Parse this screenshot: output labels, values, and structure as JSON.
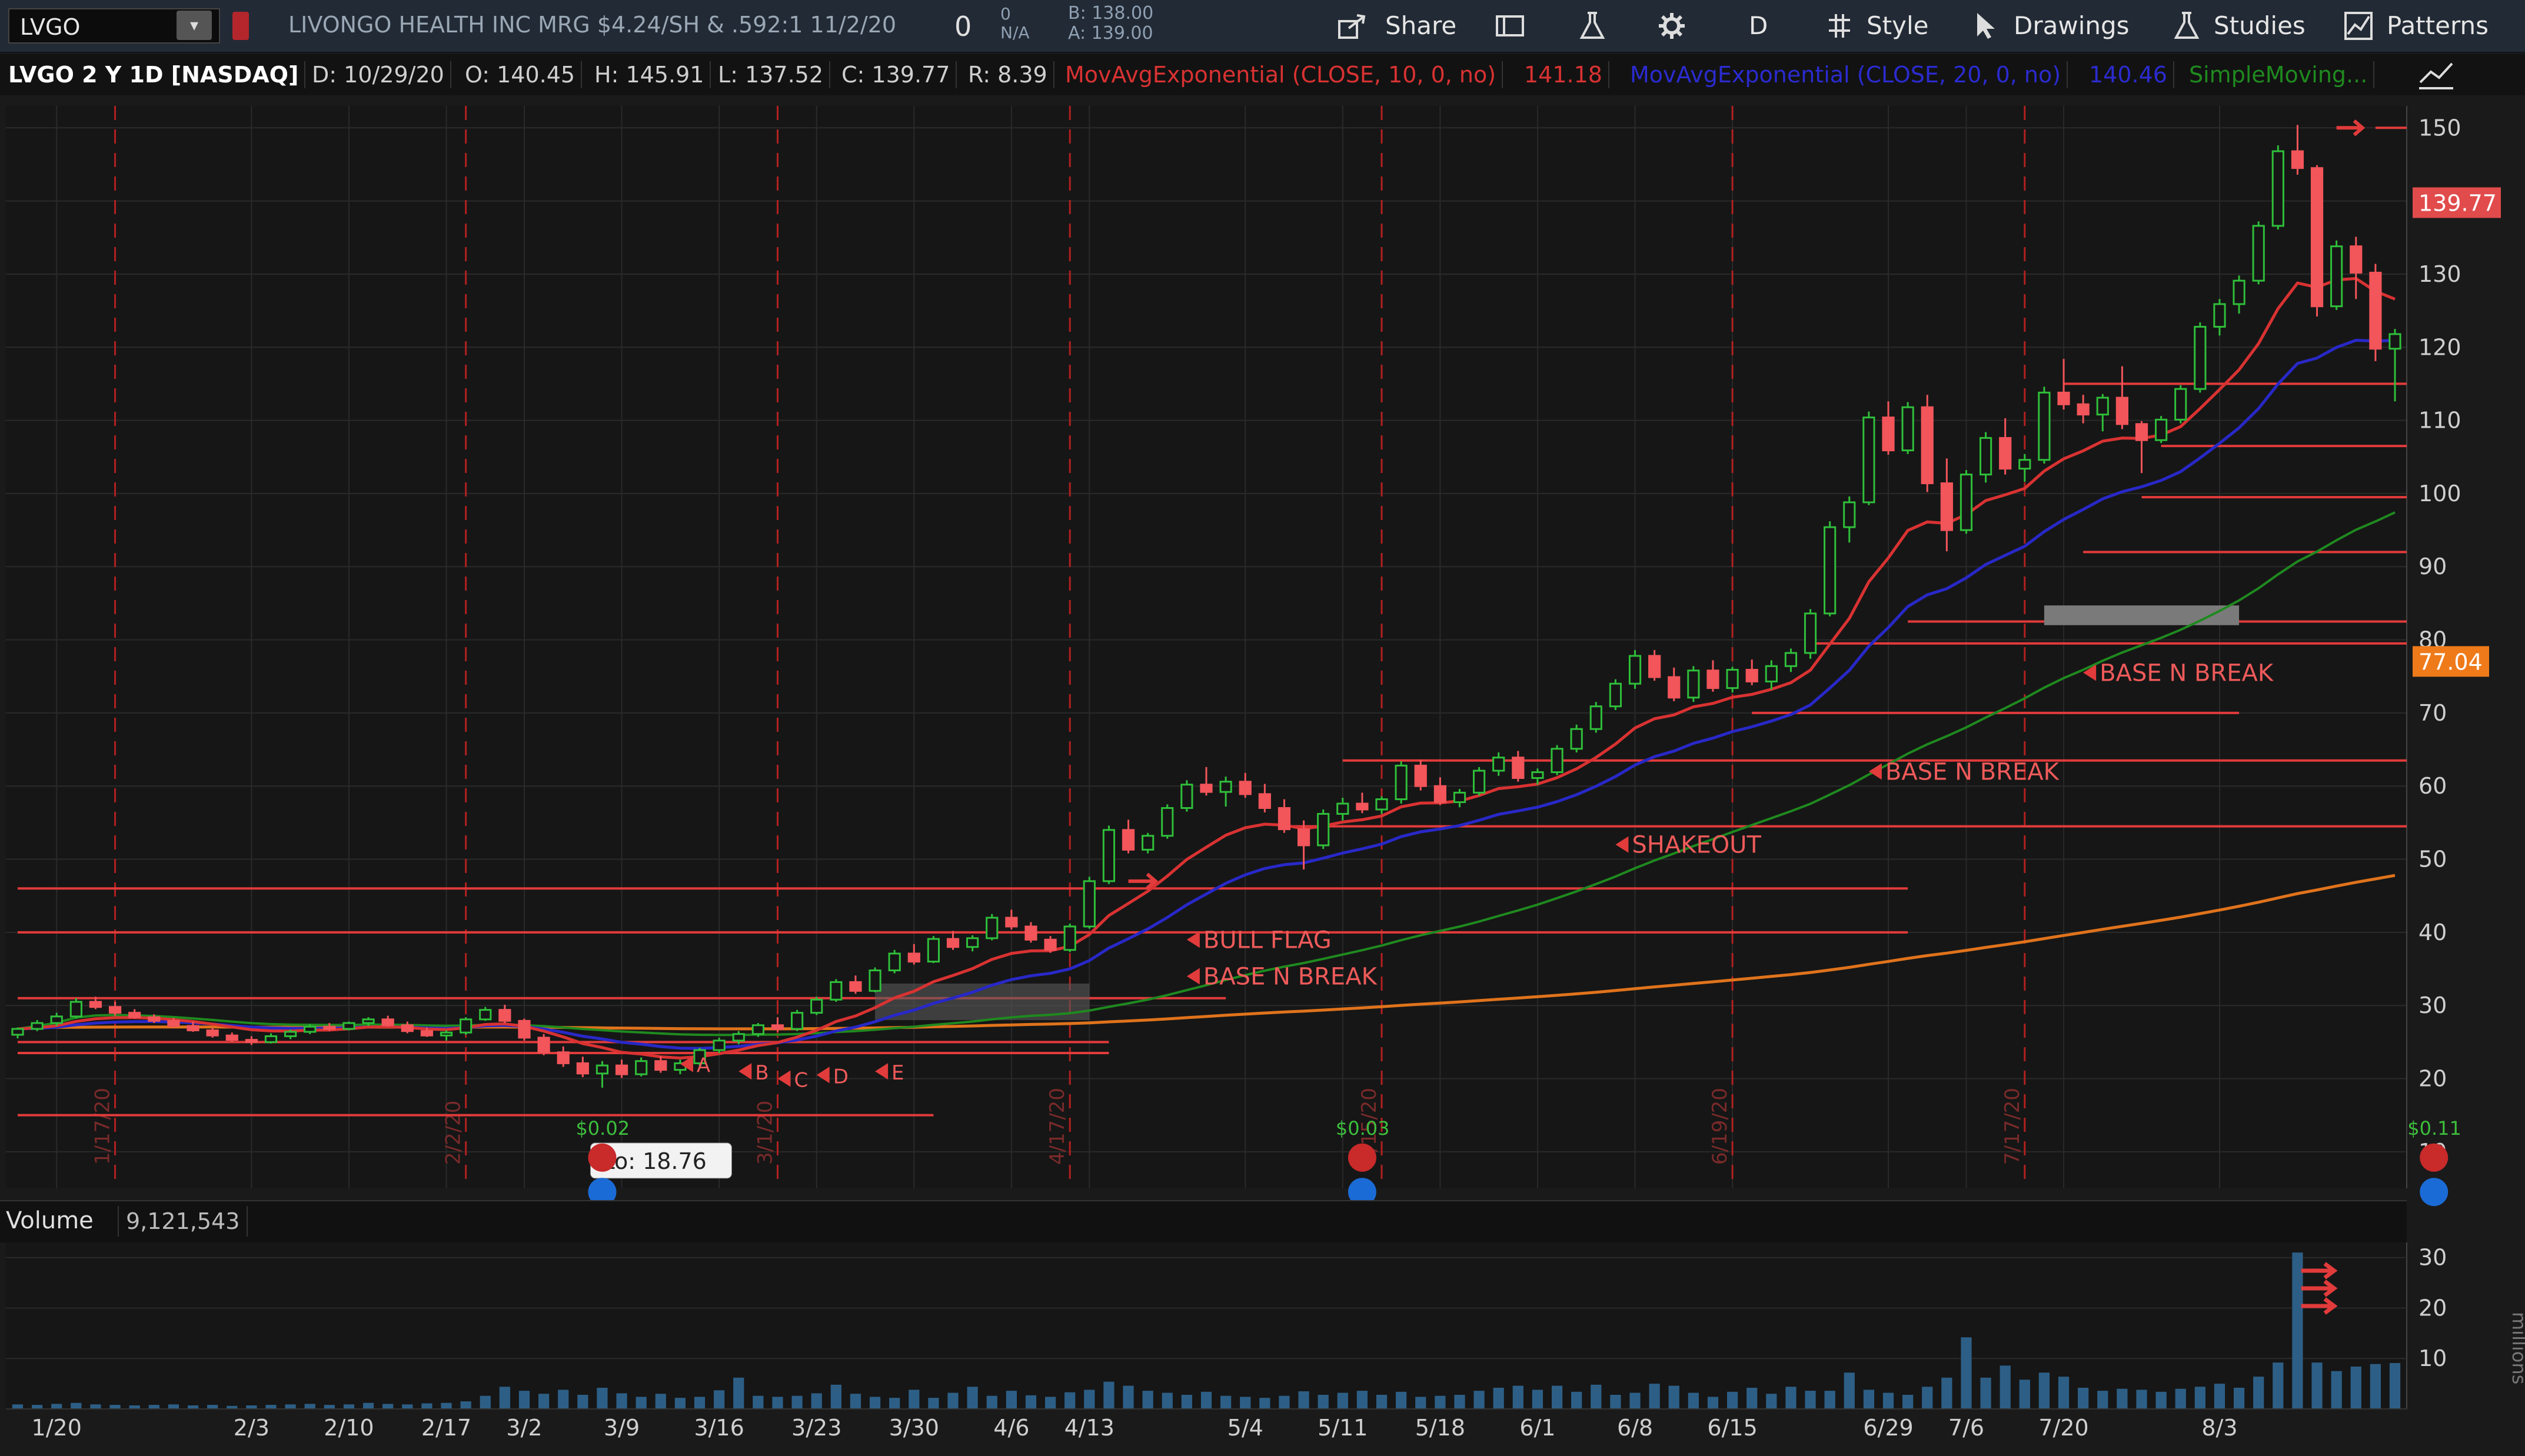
{
  "toolbar": {
    "symbol": "LVGO",
    "description": "LIVONGO HEALTH INC MRG $4.24/SH & .592:1 11/2/20",
    "last": "0",
    "na_top": "0",
    "na_bottom": "N/A",
    "bid": "B: 138.00",
    "ask": "A: 139.00",
    "share": "Share",
    "period": "D",
    "style": "Style",
    "drawings": "Drawings",
    "studies": "Studies",
    "patterns": "Patterns"
  },
  "legend": {
    "title": "LVGO 2 Y 1D [NASDAQ]",
    "date": "D: 10/29/20",
    "open": "O: 140.45",
    "high": "H: 145.91",
    "low": "L: 137.52",
    "close": "C: 139.77",
    "range": "R: 8.39",
    "ema10": "MovAvgExponential (CLOSE, 10, 0, no)",
    "ema10_val": "141.18",
    "ema20": "MovAvgExponential (CLOSE, 20, 0, no)",
    "ema20_val": "140.46",
    "sma": "SimpleMoving..."
  },
  "volume": {
    "label": "Volume",
    "value": "9,121,543"
  },
  "colors": {
    "up": "#2fbf3a",
    "down": "#f2555a",
    "ema10": "#d93232",
    "ema20": "#2828c8",
    "sma50": "#1f8a1f",
    "sma200": "#e0731c",
    "level": "#e23b3b",
    "grid": "#2a2a2a",
    "vol": "#2d5f86"
  },
  "chart_data": {
    "type": "candlestick",
    "price_axis": {
      "min": 5,
      "max": 153,
      "ticks": [
        10,
        20,
        30,
        40,
        50,
        60,
        70,
        80,
        90,
        100,
        110,
        120,
        130,
        140,
        150
      ]
    },
    "price_labels": {
      "last": "139.77",
      "level": "77.04"
    },
    "x_labels": [
      {
        "i": 2,
        "t": "1/20"
      },
      {
        "i": 12,
        "t": "2/3"
      },
      {
        "i": 17,
        "t": "2/10"
      },
      {
        "i": 22,
        "t": "2/17"
      },
      {
        "i": 26,
        "t": "3/2"
      },
      {
        "i": 31,
        "t": "3/9"
      },
      {
        "i": 36,
        "t": "3/16"
      },
      {
        "i": 41,
        "t": "3/23"
      },
      {
        "i": 46,
        "t": "3/30"
      },
      {
        "i": 51,
        "t": "4/6"
      },
      {
        "i": 55,
        "t": "4/13"
      },
      {
        "i": 63,
        "t": "5/4"
      },
      {
        "i": 68,
        "t": "5/11"
      },
      {
        "i": 73,
        "t": "5/18"
      },
      {
        "i": 78,
        "t": "6/1"
      },
      {
        "i": 83,
        "t": "6/8"
      },
      {
        "i": 88,
        "t": "6/15"
      },
      {
        "i": 96,
        "t": "6/29"
      },
      {
        "i": 100,
        "t": "7/6"
      },
      {
        "i": 105,
        "t": "7/20"
      },
      {
        "i": 113,
        "t": "8/3"
      }
    ],
    "month_lines": [
      {
        "i": 5,
        "t": "1/17/20"
      },
      {
        "i": 23,
        "t": "2/2/20"
      },
      {
        "i": 39,
        "t": "3/1/20"
      },
      {
        "i": 54,
        "t": "4/17/20"
      },
      {
        "i": 70,
        "t": "5/15/20"
      },
      {
        "i": 88,
        "t": "6/19/20"
      },
      {
        "i": 103,
        "t": "7/17/20"
      }
    ],
    "ohlc": [
      [
        26,
        27,
        25.5,
        26.8
      ],
      [
        26.8,
        28,
        26.5,
        27.6
      ],
      [
        27.6,
        29,
        27.2,
        28.5
      ],
      [
        28.5,
        31,
        28.2,
        30.5
      ],
      [
        30.5,
        31.2,
        29.5,
        29.8
      ],
      [
        29.8,
        30.5,
        28.6,
        29
      ],
      [
        29,
        29.5,
        28.2,
        28.4
      ],
      [
        28.4,
        28.8,
        27.6,
        27.9
      ],
      [
        27.9,
        28.3,
        26.9,
        27.2
      ],
      [
        27.2,
        27.8,
        26.4,
        26.6
      ],
      [
        26.6,
        27,
        25.6,
        25.9
      ],
      [
        25.9,
        26.3,
        25,
        25.3
      ],
      [
        25.3,
        25.8,
        24.6,
        25
      ],
      [
        25,
        26.2,
        24.8,
        25.8
      ],
      [
        25.8,
        26.7,
        25.4,
        26.4
      ],
      [
        26.4,
        27.4,
        26.1,
        27.1
      ],
      [
        27.1,
        27.6,
        26.5,
        26.8
      ],
      [
        26.8,
        27.8,
        26.6,
        27.6
      ],
      [
        27.6,
        28.4,
        27.2,
        28.1
      ],
      [
        28.1,
        28.6,
        27.1,
        27.3
      ],
      [
        27.3,
        27.8,
        26.2,
        26.5
      ],
      [
        26.5,
        27,
        25.7,
        25.9
      ],
      [
        25.9,
        26.6,
        25.2,
        26.3
      ],
      [
        26.3,
        28.4,
        26,
        28.1
      ],
      [
        28.1,
        29.8,
        27.9,
        29.4
      ],
      [
        29.4,
        30.1,
        27.6,
        27.9
      ],
      [
        27.9,
        28.2,
        25.2,
        25.6
      ],
      [
        25.6,
        26.1,
        23.2,
        23.6
      ],
      [
        23.6,
        24.4,
        21.6,
        22.1
      ],
      [
        22.1,
        23,
        20.2,
        20.7
      ],
      [
        20.7,
        22.4,
        18.76,
        21.8
      ],
      [
        21.8,
        22.6,
        20.1,
        20.6
      ],
      [
        20.6,
        22.9,
        20.3,
        22.4
      ],
      [
        22.4,
        23.1,
        20.8,
        21.2
      ],
      [
        21.2,
        22.6,
        20.6,
        22.1
      ],
      [
        22.1,
        24.2,
        21.8,
        23.9
      ],
      [
        23.9,
        25.6,
        23.5,
        25.2
      ],
      [
        25.2,
        26.5,
        24.7,
        26.1
      ],
      [
        26.1,
        27.6,
        25.7,
        27.3
      ],
      [
        27.3,
        28.4,
        26.4,
        26.8
      ],
      [
        26.8,
        29.4,
        26.5,
        29
      ],
      [
        29,
        31.2,
        28.7,
        30.8
      ],
      [
        30.8,
        33.6,
        30.5,
        33.2
      ],
      [
        33.2,
        34.1,
        31.6,
        32
      ],
      [
        32,
        35.2,
        31.8,
        34.8
      ],
      [
        34.8,
        37.6,
        34.4,
        37.1
      ],
      [
        37.1,
        38.4,
        35.6,
        36
      ],
      [
        36,
        39.5,
        35.8,
        39.1
      ],
      [
        39.1,
        40.2,
        37.6,
        38
      ],
      [
        38,
        39.6,
        37.4,
        39.2
      ],
      [
        39.2,
        42.5,
        38.9,
        42
      ],
      [
        42,
        43.1,
        40.4,
        40.8
      ],
      [
        40.8,
        41.4,
        38.6,
        39
      ],
      [
        39,
        39.5,
        37.2,
        37.6
      ],
      [
        37.6,
        41.2,
        37.3,
        40.8
      ],
      [
        40.8,
        47.6,
        40.5,
        47
      ],
      [
        47,
        54.6,
        46.6,
        54
      ],
      [
        54,
        55.4,
        50.8,
        51.3
      ],
      [
        51.3,
        53.6,
        50.8,
        53.2
      ],
      [
        53.2,
        57.5,
        52.8,
        57
      ],
      [
        57,
        60.8,
        56.5,
        60.2
      ],
      [
        60.2,
        62.6,
        58.7,
        59.2
      ],
      [
        59.2,
        61.3,
        57.2,
        60.6
      ],
      [
        60.6,
        61.8,
        58.4,
        58.9
      ],
      [
        58.9,
        60.3,
        56.4,
        57
      ],
      [
        57,
        58.2,
        53.6,
        54.1
      ],
      [
        54.1,
        55.3,
        48.6,
        51.9
      ],
      [
        51.9,
        56.8,
        51.4,
        56.2
      ],
      [
        56.2,
        58.4,
        55.3,
        57.6
      ],
      [
        57.6,
        59.1,
        56.3,
        56.8
      ],
      [
        56.8,
        58.6,
        56.2,
        58.2
      ],
      [
        58.2,
        63.4,
        57.6,
        62.8
      ],
      [
        62.8,
        63.6,
        59.4,
        60
      ],
      [
        60,
        61.2,
        57.4,
        57.8
      ],
      [
        57.8,
        59.6,
        57.1,
        59.1
      ],
      [
        59.1,
        62.6,
        58.7,
        62.1
      ],
      [
        62.1,
        64.6,
        61.4,
        63.9
      ],
      [
        63.9,
        64.8,
        60.6,
        61.1
      ],
      [
        61.1,
        62.4,
        60.2,
        61.9
      ],
      [
        61.9,
        65.6,
        61.5,
        65.1
      ],
      [
        65.1,
        68.4,
        64.6,
        67.8
      ],
      [
        67.8,
        71.5,
        67.3,
        70.9
      ],
      [
        70.9,
        74.6,
        70.4,
        74
      ],
      [
        74,
        78.6,
        73.3,
        77.8
      ],
      [
        77.8,
        78.6,
        74.4,
        74.9
      ],
      [
        74.9,
        76.2,
        71.6,
        72.1
      ],
      [
        72.1,
        76.4,
        71.5,
        75.8
      ],
      [
        75.8,
        77.2,
        72.9,
        73.4
      ],
      [
        73.4,
        76.3,
        72.8,
        75.9
      ],
      [
        75.9,
        77.3,
        73.8,
        74.3
      ],
      [
        74.3,
        77.2,
        73.2,
        76.4
      ],
      [
        76.4,
        78.8,
        75.6,
        78.2
      ],
      [
        78.2,
        84.2,
        77.4,
        83.6
      ],
      [
        83.6,
        96.2,
        83.2,
        95.4
      ],
      [
        95.4,
        99.6,
        93.3,
        98.8
      ],
      [
        98.8,
        111.2,
        98.4,
        110.4
      ],
      [
        110.4,
        112.6,
        105.3,
        105.9
      ],
      [
        105.9,
        112.5,
        105.4,
        111.8
      ],
      [
        111.8,
        113.5,
        100.2,
        101.4
      ],
      [
        101.4,
        104.8,
        92.1,
        95
      ],
      [
        95,
        103.2,
        94.5,
        102.6
      ],
      [
        102.6,
        108.4,
        101.5,
        107.6
      ],
      [
        107.6,
        110.3,
        102.6,
        103.4
      ],
      [
        103.4,
        105.4,
        101.6,
        104.6
      ],
      [
        104.6,
        114.6,
        104.1,
        113.8
      ],
      [
        113.8,
        118.4,
        111.5,
        112.2
      ],
      [
        112.2,
        113.5,
        109.6,
        110.8
      ],
      [
        110.8,
        113.6,
        108.5,
        113.1
      ],
      [
        113.1,
        117.4,
        108.8,
        109.5
      ],
      [
        109.5,
        109.9,
        102.8,
        107.3
      ],
      [
        107.3,
        110.6,
        106.9,
        110.1
      ],
      [
        110.1,
        114.8,
        109.6,
        114.3
      ],
      [
        114.3,
        123.4,
        113.8,
        122.8
      ],
      [
        122.8,
        126.6,
        121.6,
        125.9
      ],
      [
        125.9,
        129.8,
        124.6,
        129.1
      ],
      [
        129.1,
        137.2,
        128.6,
        136.6
      ],
      [
        136.6,
        147.6,
        136.1,
        146.8
      ],
      [
        146.8,
        150.4,
        143.6,
        144.5
      ],
      [
        144.5,
        144.9,
        124.2,
        125.6
      ],
      [
        125.6,
        134.6,
        125.1,
        133.8
      ],
      [
        133.8,
        135.1,
        126.6,
        130.2
      ],
      [
        130.2,
        131.4,
        118.1,
        119.8
      ],
      [
        119.8,
        122.5,
        112.6,
        121.8
      ]
    ],
    "volume_millions": [
      0.9,
      0.8,
      1,
      1.2,
      0.9,
      0.8,
      0.7,
      0.8,
      0.9,
      0.7,
      0.8,
      0.6,
      0.7,
      0.8,
      0.9,
      1,
      0.8,
      0.9,
      1.2,
      1,
      0.9,
      1.1,
      1.2,
      1.5,
      2.6,
      4.4,
      3.6,
      3,
      3.8,
      2.8,
      4.2,
      3.1,
      2.4,
      3,
      2.2,
      2.4,
      3.7,
      6.2,
      2.6,
      2.4,
      2.6,
      3.1,
      4.8,
      3,
      2.4,
      2.2,
      3.8,
      2.2,
      3.2,
      4.4,
      2.6,
      3.6,
      2.7,
      2.4,
      3.3,
      3.8,
      5.4,
      4.6,
      3.6,
      3.2,
      2.8,
      3.4,
      2.6,
      2.4,
      2.2,
      2.6,
      3.5,
      2.8,
      3.2,
      3.6,
      2.8,
      3.4,
      2.4,
      2.6,
      2.8,
      3.6,
      4.2,
      4.6,
      3.8,
      4.6,
      3.4,
      4.8,
      2.8,
      3.2,
      5,
      4.6,
      3.2,
      2.4,
      3.4,
      4.2,
      3,
      4.4,
      3.6,
      3.6,
      7.2,
      3.8,
      3.2,
      2.8,
      4.4,
      6.2,
      14.2,
      6.2,
      8.6,
      5.8,
      7.2,
      6.4,
      4.2,
      3.6,
      4,
      3.8,
      3.4,
      4,
      4.4,
      5,
      4.2,
      6.4,
      9.2,
      31,
      9.2,
      7.5,
      8.4,
      8.9,
      9.1
    ],
    "volume_axis": {
      "ticks": [
        10,
        20,
        30
      ],
      "unit": "millions"
    },
    "horizontal_levels": [
      {
        "v": 23.5,
        "from": 0,
        "to": 56
      },
      {
        "v": 25,
        "from": 0,
        "to": 56
      },
      {
        "v": 31,
        "from": 0,
        "to": 62
      },
      {
        "v": 15,
        "from": 0,
        "to": 47
      },
      {
        "v": 40,
        "from": 0,
        "to": 97
      },
      {
        "v": 46,
        "from": 0,
        "to": 97
      },
      {
        "v": 54.5,
        "from": 65,
        "to": 127
      },
      {
        "v": 63.5,
        "from": 68,
        "to": 127
      },
      {
        "v": 70,
        "from": 89,
        "to": 114
      },
      {
        "v": 79.5,
        "from": 92,
        "to": 127
      },
      {
        "v": 82.5,
        "from": 97,
        "to": 127
      },
      {
        "v": 92,
        "from": 106,
        "to": 127
      },
      {
        "v": 99.5,
        "from": 109,
        "to": 127
      },
      {
        "v": 106.5,
        "from": 110,
        "to": 127
      },
      {
        "v": 115,
        "from": 105,
        "to": 127
      },
      {
        "v": 150,
        "from": 121,
        "to": 127
      }
    ],
    "annotations": [
      {
        "i": 60,
        "v": 39,
        "t": "BULL FLAG"
      },
      {
        "i": 60,
        "v": 34,
        "t": "BASE N BREAK"
      },
      {
        "i": 82,
        "v": 52,
        "t": "SHAKEOUT"
      },
      {
        "i": 95,
        "v": 62,
        "t": "BASE N BREAK"
      },
      {
        "i": 106,
        "v": 75.5,
        "t": "BASE N BREAK"
      },
      {
        "i": 34,
        "v": 22,
        "t": "A"
      },
      {
        "i": 37,
        "v": 21,
        "t": "B"
      },
      {
        "i": 39,
        "v": 20,
        "t": "C"
      },
      {
        "i": 41,
        "v": 20.5,
        "t": "D"
      },
      {
        "i": 44,
        "v": 21,
        "t": "E"
      }
    ],
    "lo_tooltip": "Lo: 18.76",
    "earnings": [
      {
        "i": 30,
        "t": "$0.02"
      },
      {
        "i": 69,
        "t": "$0.03"
      },
      {
        "i": 124,
        "t": "$0.11"
      }
    ]
  }
}
